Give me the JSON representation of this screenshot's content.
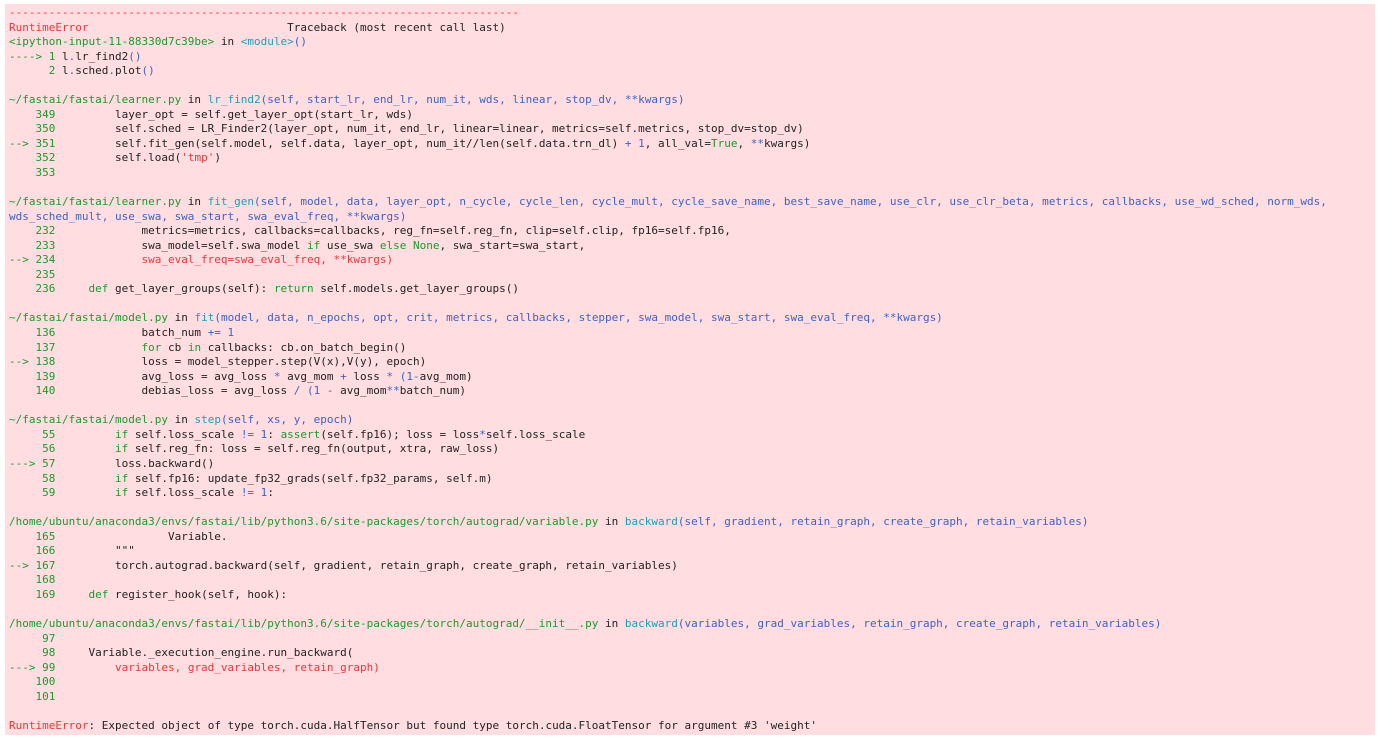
{
  "traceback": {
    "lines": [
      [
        [
          "red",
          "-----------------------------------------------------------------------------"
        ]
      ],
      [
        [
          "red",
          "RuntimeError"
        ],
        [
          "k",
          "                              Traceback (most recent call last)"
        ]
      ],
      [
        [
          "green",
          "<ipython-input-11-88330d7c39be>"
        ],
        [
          "k",
          " in "
        ],
        [
          "cyan",
          "<module>"
        ],
        [
          "blue",
          "()"
        ]
      ],
      [
        [
          "green",
          "----> 1 "
        ],
        [
          "k",
          "l"
        ],
        [
          "blue",
          "."
        ],
        [
          "k",
          "lr_find2"
        ],
        [
          "blue",
          "()"
        ]
      ],
      [
        [
          "green",
          "      2 "
        ],
        [
          "k",
          "l"
        ],
        [
          "blue",
          "."
        ],
        [
          "k",
          "sched"
        ],
        [
          "blue",
          "."
        ],
        [
          "k",
          "plot"
        ],
        [
          "blue",
          "()"
        ]
      ],
      [],
      [
        [
          "green",
          "~/fastai/fastai/learner.py"
        ],
        [
          "k",
          " in "
        ],
        [
          "cyan",
          "lr_find2"
        ],
        [
          "blue",
          "(self, start_lr, end_lr, num_it, wds, linear, stop_dv, **kwargs)"
        ]
      ],
      [
        [
          "green",
          "    349         "
        ],
        [
          "k",
          "layer_opt = self.get_layer_opt(start_lr, wds)"
        ]
      ],
      [
        [
          "green",
          "    350         "
        ],
        [
          "k",
          "self.sched = LR_Finder2(layer_opt, num_it, end_lr, linear=linear, metrics=self.metrics, stop_dv=stop_dv)"
        ]
      ],
      [
        [
          "green",
          "--> 351         "
        ],
        [
          "k",
          "self.fit_gen(self.model, self.data, layer_opt, num_it//len(self.data.trn_dl) "
        ],
        [
          "blue",
          "+ 1"
        ],
        [
          "k",
          ", all_val="
        ],
        [
          "green",
          "True"
        ],
        [
          "k",
          ", "
        ],
        [
          "blue",
          "**"
        ],
        [
          "k",
          "kwargs)"
        ]
      ],
      [
        [
          "green",
          "    352         "
        ],
        [
          "k",
          "self.load("
        ],
        [
          "red",
          "'tmp'"
        ],
        [
          "k",
          ")"
        ]
      ],
      [
        [
          "green",
          "    353"
        ]
      ],
      [],
      [
        [
          "green",
          "~/fastai/fastai/learner.py"
        ],
        [
          "k",
          " in "
        ],
        [
          "cyan",
          "fit_gen"
        ],
        [
          "blue",
          "(self, model, data, layer_opt, n_cycle, cycle_len, cycle_mult, cycle_save_name, best_save_name, use_clr, use_clr_beta, metrics, callbacks, use_wd_sched, norm_wds, wds_sched_mult, use_swa, swa_start, swa_eval_freq, **kwargs)"
        ]
      ],
      [
        [
          "green",
          "    232             "
        ],
        [
          "k",
          "metrics=metrics, callbacks=callbacks, reg_fn=self.reg_fn, clip=self.clip, fp16=self.fp16,"
        ]
      ],
      [
        [
          "green",
          "    233             "
        ],
        [
          "k",
          "swa_model=self.swa_model "
        ],
        [
          "green",
          "if"
        ],
        [
          "k",
          " use_swa "
        ],
        [
          "green",
          "else"
        ],
        [
          "k",
          " "
        ],
        [
          "green",
          "None"
        ],
        [
          "k",
          ", swa_start=swa_start,"
        ]
      ],
      [
        [
          "green",
          "--> 234             "
        ],
        [
          "red",
          "swa_eval_freq=swa_eval_freq, **kwargs)"
        ]
      ],
      [
        [
          "green",
          "    235"
        ]
      ],
      [
        [
          "green",
          "    236     "
        ],
        [
          "green",
          "def"
        ],
        [
          "k",
          " get_layer_groups(self): "
        ],
        [
          "green",
          "return"
        ],
        [
          "k",
          " self.models.get_layer_groups()"
        ]
      ],
      [],
      [
        [
          "green",
          "~/fastai/fastai/model.py"
        ],
        [
          "k",
          " in "
        ],
        [
          "cyan",
          "fit"
        ],
        [
          "blue",
          "(model, data, n_epochs, opt, crit, metrics, callbacks, stepper, swa_model, swa_start, swa_eval_freq, **kwargs)"
        ]
      ],
      [
        [
          "green",
          "    136             "
        ],
        [
          "k",
          "batch_num "
        ],
        [
          "blue",
          "+= 1"
        ]
      ],
      [
        [
          "green",
          "    137             "
        ],
        [
          "green",
          "for"
        ],
        [
          "k",
          " cb "
        ],
        [
          "green",
          "in"
        ],
        [
          "k",
          " callbacks: cb.on_batch_begin()"
        ]
      ],
      [
        [
          "green",
          "--> 138             "
        ],
        [
          "k",
          "loss = model_stepper.step(V(x),V(y), epoch)"
        ]
      ],
      [
        [
          "green",
          "    139             "
        ],
        [
          "k",
          "avg_loss = avg_loss "
        ],
        [
          "blue",
          "*"
        ],
        [
          "k",
          " avg_mom "
        ],
        [
          "blue",
          "+"
        ],
        [
          "k",
          " loss "
        ],
        [
          "blue",
          "*"
        ],
        [
          "k",
          " "
        ],
        [
          "blue",
          "(1-"
        ],
        [
          "k",
          "avg_mom)"
        ]
      ],
      [
        [
          "green",
          "    140             "
        ],
        [
          "k",
          "debias_loss = avg_loss "
        ],
        [
          "blue",
          "/ (1 -"
        ],
        [
          "k",
          " avg_mom"
        ],
        [
          "blue",
          "**"
        ],
        [
          "k",
          "batch_num)"
        ]
      ],
      [],
      [
        [
          "green",
          "~/fastai/fastai/model.py"
        ],
        [
          "k",
          " in "
        ],
        [
          "cyan",
          "step"
        ],
        [
          "blue",
          "(self, xs, y, epoch)"
        ]
      ],
      [
        [
          "green",
          "     55         "
        ],
        [
          "green",
          "if"
        ],
        [
          "k",
          " self.loss_scale "
        ],
        [
          "blue",
          "!= 1"
        ],
        [
          "k",
          ": "
        ],
        [
          "green",
          "assert"
        ],
        [
          "k",
          "(self.fp16); loss = loss"
        ],
        [
          "blue",
          "*"
        ],
        [
          "k",
          "self.loss_scale"
        ]
      ],
      [
        [
          "green",
          "     56         "
        ],
        [
          "green",
          "if"
        ],
        [
          "k",
          " self.reg_fn: loss = self.reg_fn(output, xtra, raw_loss)"
        ]
      ],
      [
        [
          "green",
          "---> 57         "
        ],
        [
          "k",
          "loss.backward()"
        ]
      ],
      [
        [
          "green",
          "     58         "
        ],
        [
          "green",
          "if"
        ],
        [
          "k",
          " self.fp16: update_fp32_grads(self.fp32_params, self.m)"
        ]
      ],
      [
        [
          "green",
          "     59         "
        ],
        [
          "green",
          "if"
        ],
        [
          "k",
          " self.loss_scale "
        ],
        [
          "blue",
          "!= 1"
        ],
        [
          "k",
          ":"
        ]
      ],
      [],
      [
        [
          "green",
          "/home/ubuntu/anaconda3/envs/fastai/lib/python3.6/site-packages/torch/autograd/variable.py"
        ],
        [
          "k",
          " in "
        ],
        [
          "cyan",
          "backward"
        ],
        [
          "blue",
          "(self, gradient, retain_graph, create_graph, retain_variables)"
        ]
      ],
      [
        [
          "green",
          "    165                 "
        ],
        [
          "k",
          "Variable."
        ]
      ],
      [
        [
          "green",
          "    166         "
        ],
        [
          "k",
          "\"\"\""
        ]
      ],
      [
        [
          "green",
          "--> 167         "
        ],
        [
          "k",
          "torch.autograd.backward(self, gradient, retain_graph, create_graph, retain_variables)"
        ]
      ],
      [
        [
          "green",
          "    168"
        ]
      ],
      [
        [
          "green",
          "    169     "
        ],
        [
          "green",
          "def"
        ],
        [
          "k",
          " register_hook(self, hook):"
        ]
      ],
      [],
      [
        [
          "green",
          "/home/ubuntu/anaconda3/envs/fastai/lib/python3.6/site-packages/torch/autograd/__init__.py"
        ],
        [
          "k",
          " in "
        ],
        [
          "cyan",
          "backward"
        ],
        [
          "blue",
          "(variables, grad_variables, retain_graph, create_graph, retain_variables)"
        ]
      ],
      [
        [
          "green",
          "     97"
        ]
      ],
      [
        [
          "green",
          "     98     "
        ],
        [
          "k",
          "Variable._execution_engine.run_backward("
        ]
      ],
      [
        [
          "green",
          "---> 99         "
        ],
        [
          "red",
          "variables, grad_variables, retain_graph)"
        ]
      ],
      [
        [
          "green",
          "    100"
        ]
      ],
      [
        [
          "green",
          "    101"
        ]
      ],
      [],
      [
        [
          "red",
          "RuntimeError"
        ],
        [
          "k",
          ": Expected object of type torch.cuda.HalfTensor but found type torch.cuda.FloatTensor for argument #3 'weight'"
        ]
      ]
    ]
  }
}
